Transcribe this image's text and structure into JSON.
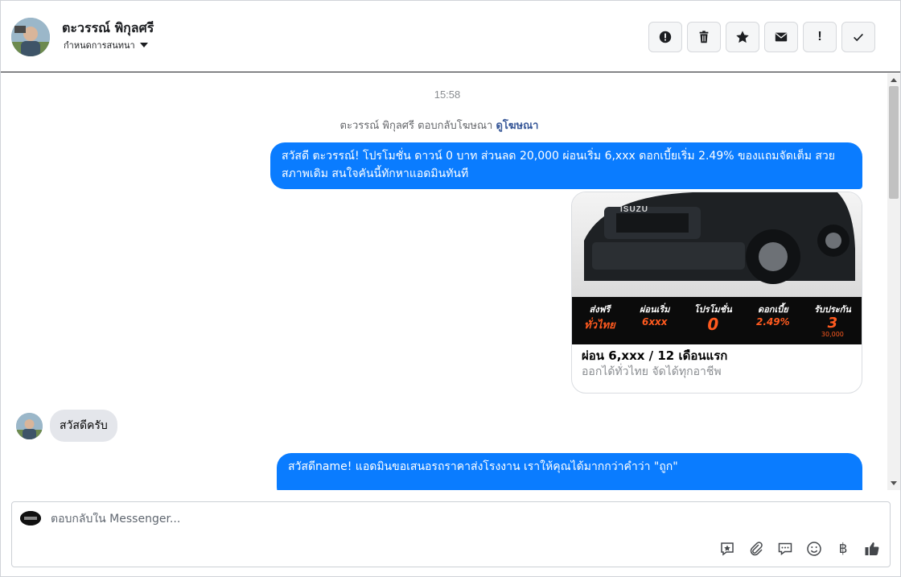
{
  "header": {
    "contact_name": "ตะวรรณ์ พิกุลศรี",
    "assign_label": "กำหนดการสนทนา",
    "actions": [
      {
        "icon": "alert-circle-icon"
      },
      {
        "icon": "trash-icon"
      },
      {
        "icon": "star-icon"
      },
      {
        "icon": "envelope-icon"
      },
      {
        "icon": "exclamation-icon",
        "label": "!"
      },
      {
        "icon": "checkmark-icon"
      }
    ]
  },
  "thread": {
    "timestamp": "15:58",
    "ad_reply_text": "ตะวรรณ์ พิกุลศรี ตอบกลับโฆษณา",
    "ad_reply_link": "ดูโฆษณา",
    "messages": [
      {
        "direction": "outgoing",
        "text": "สวัสดี ตะวรรณ์! โปรโมชั่น ดาวน์ 0 บาท ส่วนลด 20,000 ผ่อนเริ่ม 6,xxx ดอกเบี้ยเริ่ม 2.49% ของแถมจัดเต็ม สวยสภาพเดิม สนใจคันนี้ทักหาแอดมินทันที"
      },
      {
        "direction": "incoming",
        "text": "สวัสดีครับ"
      },
      {
        "direction": "outgoing",
        "text": "สวัสดีname! แอดมินขอเสนอรถราคาส่งโรงงาน เราให้คุณได้มากกว่าคำว่า \"ถูก\""
      }
    ],
    "ad_card": {
      "title": "ผ่อน 6,xxx / 12 เดือนแรก",
      "subtitle": "ออกได้ทั่วไทย จัดได้ทุกอาชีพ",
      "brand": "ISUZU",
      "promo": [
        {
          "label": "ส่งฟรี",
          "value": "ทั่วไทย"
        },
        {
          "label": "ผ่อนเริ่ม",
          "value": "6xxx"
        },
        {
          "label": "โปรโมชั่น",
          "value": "0"
        },
        {
          "label": "ดอกเบี้ย",
          "value": "2.49%"
        },
        {
          "label": "รับประกัน",
          "value": "3",
          "extra": "30,000"
        }
      ]
    }
  },
  "composer": {
    "placeholder": "ตอบกลับใน Messenger...",
    "tools": [
      "saved-reply-icon",
      "attachment-icon",
      "chat-bubble-icon",
      "emoji-icon",
      "baht-icon",
      "like-icon"
    ],
    "baht_symbol": "฿"
  },
  "colors": {
    "outgoing_bubble": "#0a7cff",
    "incoming_bubble": "#e4e6eb",
    "link": "#385898"
  }
}
